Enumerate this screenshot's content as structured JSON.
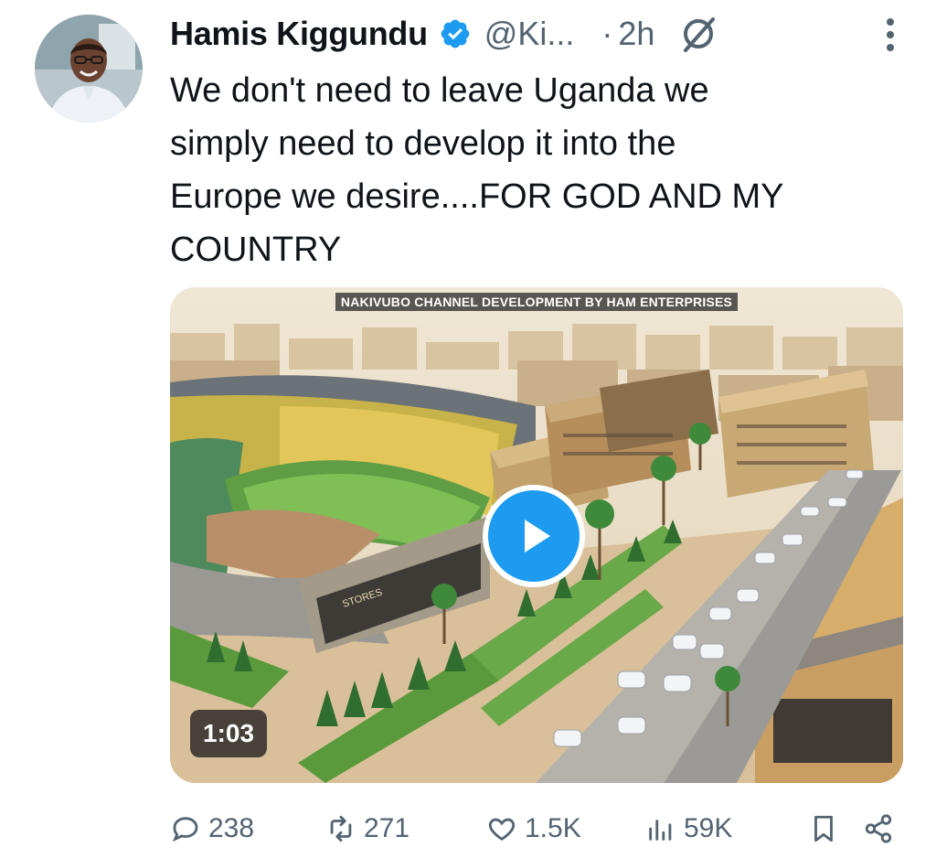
{
  "author": {
    "name": "Hamis Kiggundu",
    "handle": "@Ki...",
    "separator": "·",
    "time": "2h",
    "verified": true,
    "avatar_icon": "profile-photo"
  },
  "tweet": {
    "text": "We don't need to leave Uganda we\nsimply need to develop it into the\nEurope we desire....FOR GOD AND MY\nCOUNTRY"
  },
  "media": {
    "type": "video",
    "caption": "NAKIVUBO CHANNEL DEVELOPMENT BY HAM ENTERPRISES",
    "duration": "1:03",
    "storefront_sign": "STORES",
    "play_color": "#1d9bf0"
  },
  "actions": {
    "replies": "238",
    "reposts": "271",
    "likes": "1.5K",
    "views": "59K"
  },
  "colors": {
    "text": "#0f1419",
    "secondary": "#536471",
    "accent": "#1d9bf0"
  }
}
